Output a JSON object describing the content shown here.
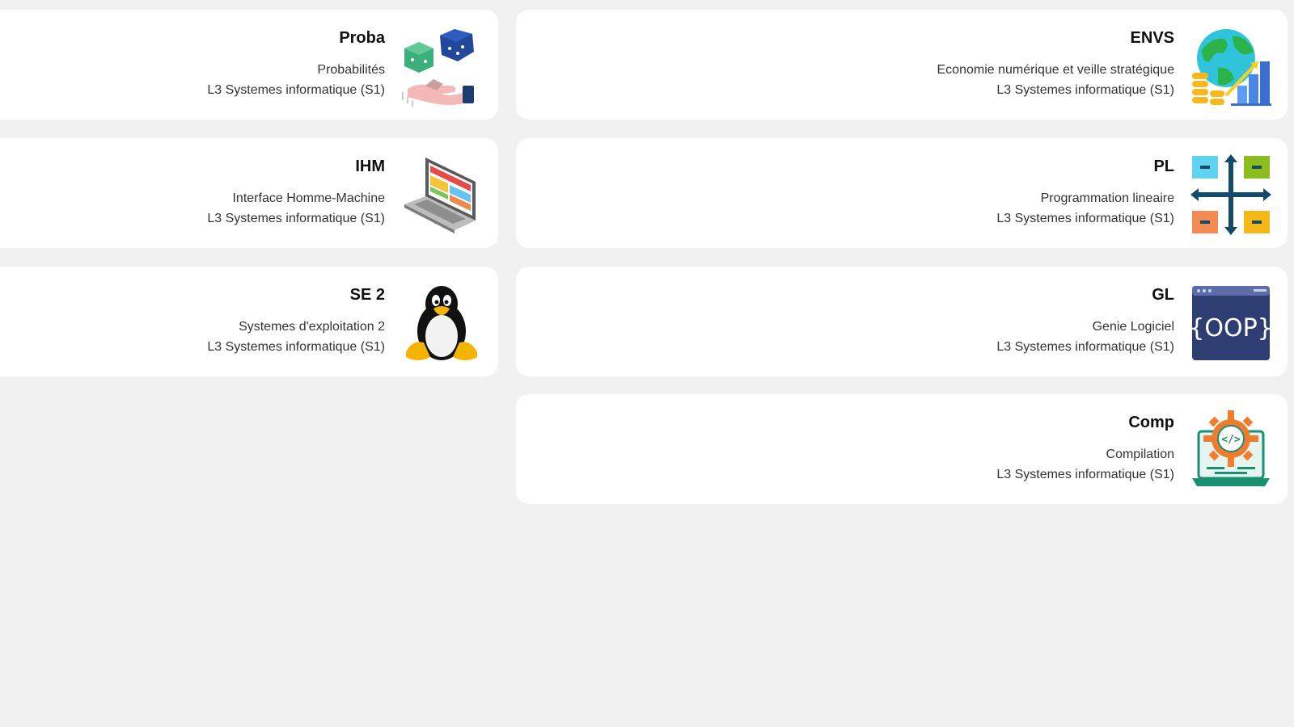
{
  "courses": [
    {
      "code": "Proba",
      "name": "Probabilités",
      "program": "L3 Systemes informatique (S1)",
      "icon": "dice-hand-icon"
    },
    {
      "code": "ENVS",
      "name": "Economie numérique et veille stratégique",
      "program": "L3 Systemes informatique (S1)",
      "icon": "globe-growth-icon"
    },
    {
      "code": "IHM",
      "name": "Interface Homme-Machine",
      "program": "L3 Systemes informatique (S1)",
      "icon": "laptop-ui-icon"
    },
    {
      "code": "PL",
      "name": "Programmation lineaire",
      "program": "L3 Systemes informatique (S1)",
      "icon": "axes-quadrants-icon"
    },
    {
      "code": "SE 2",
      "name": "Systemes d'exploitation 2",
      "program": "L3 Systemes informatique (S1)",
      "icon": "linux-penguin-icon"
    },
    {
      "code": "GL",
      "name": "Genie Logiciel",
      "program": "L3 Systemes informatique (S1)",
      "icon": "oop-window-icon"
    },
    {
      "code": "Comp",
      "name": "Compilation",
      "program": "L3 Systemes informatique (S1)",
      "icon": "laptop-gear-code-icon"
    }
  ],
  "icon_labels": {
    "oop": "{OOP}",
    "code": "</>"
  }
}
